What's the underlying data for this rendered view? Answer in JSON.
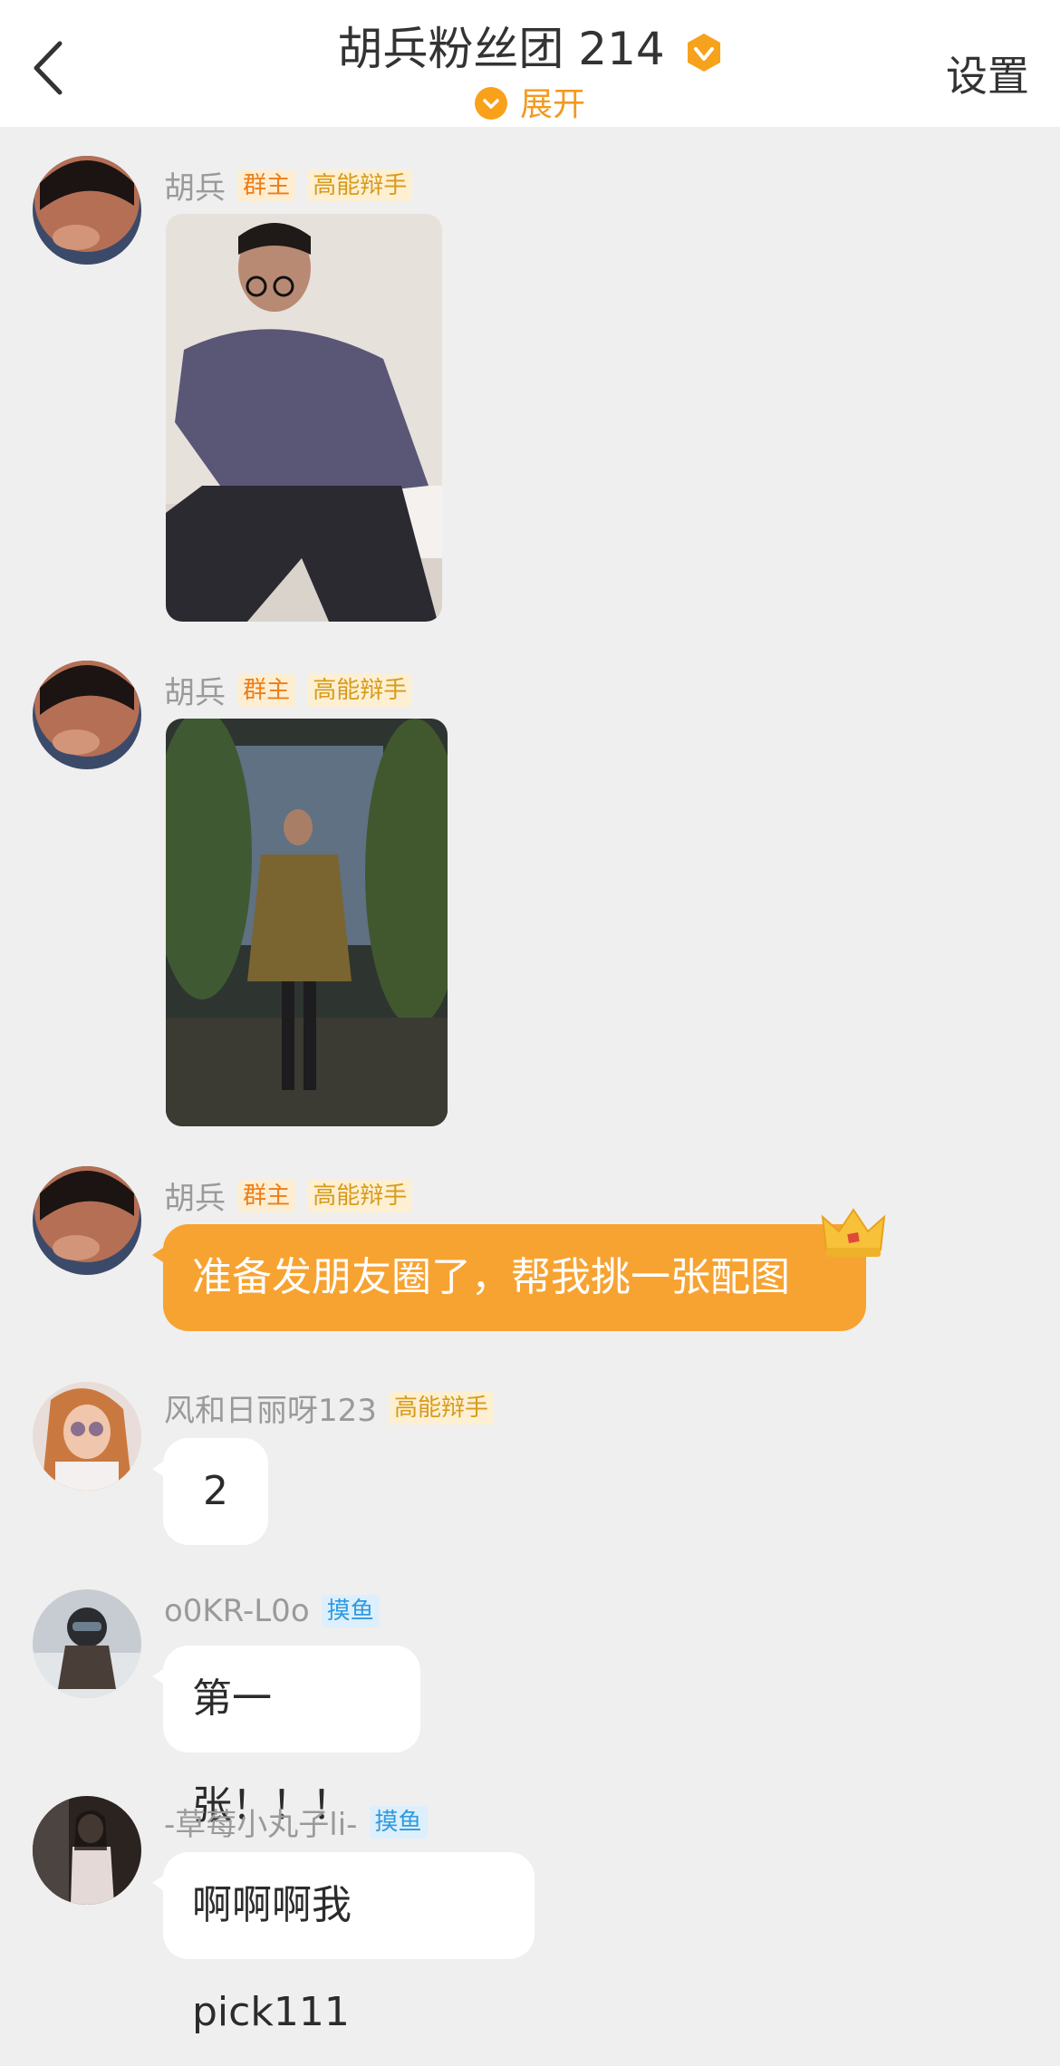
{
  "header": {
    "title": "胡兵粉丝团 214",
    "expand_label": "展开",
    "settings_label": "设置",
    "accent_color": "#f9a11b"
  },
  "messages": [
    {
      "sender": "胡兵",
      "tags": [
        "群主",
        "高能辩手"
      ],
      "type": "image",
      "image_desc": "man-in-purple-sweater-photo"
    },
    {
      "sender": "胡兵",
      "tags": [
        "群主",
        "高能辩手"
      ],
      "type": "image",
      "image_desc": "man-in-olive-coat-runway-photo"
    },
    {
      "sender": "胡兵",
      "tags": [
        "群主",
        "高能辩手"
      ],
      "type": "text",
      "text": "准备发朋友圈了，帮我挑一张配图"
    },
    {
      "sender": "风和日丽呀123",
      "tags": [
        "高能辩手"
      ],
      "type": "text",
      "text": "2"
    },
    {
      "sender": "o0KR-L0o",
      "tags": [
        "摸鱼"
      ],
      "type": "text",
      "text": "第一张！！！"
    },
    {
      "sender": "-草莓小丸子li-",
      "tags": [
        "摸鱼"
      ],
      "type": "text",
      "text": "啊啊啊我 pick111"
    }
  ]
}
